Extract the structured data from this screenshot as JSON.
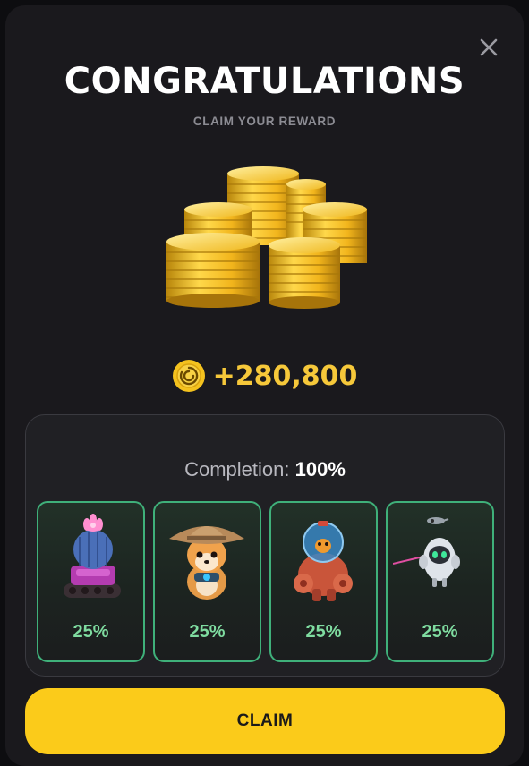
{
  "modal": {
    "title": "CONGRATULATIONS",
    "subtitle": "CLAIM YOUR REWARD",
    "close_icon": "close-icon",
    "reward": {
      "icon": "coin-icon",
      "amount": "+280,800"
    },
    "completion": {
      "label": "Completion:",
      "value": "100%"
    },
    "cards": [
      {
        "icon": "cactus-tank-icon",
        "percent": "25%"
      },
      {
        "icon": "shiba-hat-icon",
        "percent": "25%"
      },
      {
        "icon": "astronaut-robot-icon",
        "percent": "25%"
      },
      {
        "icon": "flying-drone-icon",
        "percent": "25%"
      }
    ],
    "claim_label": "CLAIM"
  },
  "colors": {
    "accent_yellow": "#fbcb1a",
    "reward_text": "#f6c83a",
    "card_border": "#3fb07a",
    "percent_text": "#7fdca0",
    "modal_bg": "#1a191d"
  }
}
